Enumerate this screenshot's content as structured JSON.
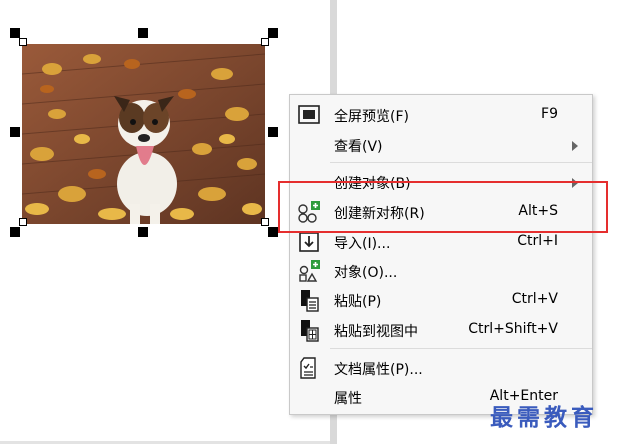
{
  "menu": {
    "items": [
      {
        "label": "全屏预览(F)",
        "shortcut": "F9",
        "icon": "fullscreen-preview-icon"
      },
      {
        "label": "查看(V)",
        "shortcut": "",
        "icon": "",
        "submenu": true
      },
      {
        "label": "创建对象(B)",
        "shortcut": "",
        "icon": "",
        "submenu": true
      },
      {
        "label": "创建新对称(R)",
        "shortcut": "Alt+S",
        "icon": "symmetry-icon"
      },
      {
        "label": "导入(I)...",
        "shortcut": "Ctrl+I",
        "icon": "import-icon"
      },
      {
        "label": "对象(O)...",
        "shortcut": "",
        "icon": "objects-icon"
      },
      {
        "label": "粘贴(P)",
        "shortcut": "Ctrl+V",
        "icon": "paste-icon"
      },
      {
        "label": "粘贴到视图中",
        "shortcut": "Ctrl+Shift+V",
        "icon": "paste-in-place-icon"
      },
      {
        "label": "文档属性(P)...",
        "shortcut": "",
        "icon": "document-properties-icon"
      },
      {
        "label": "属性",
        "shortcut": "Alt+Enter",
        "icon": ""
      }
    ]
  },
  "photo": {
    "subject": "dog-photo"
  },
  "watermark": "最需教育",
  "colors": {
    "highlight": "#e52e2e",
    "icon_green": "#2e9b3c",
    "watermark": "#3a5bbd"
  }
}
